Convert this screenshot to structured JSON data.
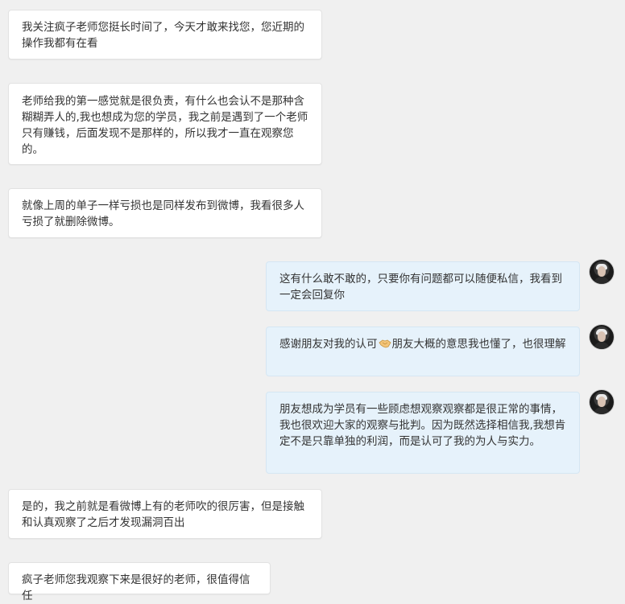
{
  "conversation": {
    "messages": [
      {
        "direction": "incoming",
        "text": "我关注疯子老师您挺长时间了，今天才敢来找您，您近期的操作我都有在看"
      },
      {
        "direction": "incoming",
        "text": "老师给我的第一感觉就是很负责，有什么也会认不是那种含糊糊弄人的,我也想成为您的学员，我之前是遇到了一个老师只有赚钱，后面发现不是那样的，所以我才一直在观察您的。"
      },
      {
        "direction": "incoming",
        "text": "就像上周的单子一样亏损也是同样发布到微博，我看很多人亏损了就删除微博。"
      },
      {
        "direction": "outgoing",
        "text": "这有什么敢不敢的，只要你有问题都可以随便私信，我看到一定会回复你"
      },
      {
        "direction": "outgoing",
        "text_before": "感谢朋友对我的认可",
        "emoji": "handshake-emoji",
        "text_after": "朋友大概的意思我也懂了，也很理解"
      },
      {
        "direction": "outgoing",
        "text": "朋友想成为学员有一些顾虑想观察观察都是很正常的事情，我也很欢迎大家的观察与批判。因为既然选择相信我,我想肯定不是只靠单独的利润，而是认可了我的为人与实力。"
      },
      {
        "direction": "incoming",
        "text": "是的，我之前就是看微博上有的老师吹的很厉害，但是接触和认真观察了之后才发现漏洞百出"
      },
      {
        "direction": "incoming",
        "text": "疯子老师您我观察下来是很好的老师，很值得信任"
      }
    ]
  },
  "colors": {
    "background": "#f0f0f0",
    "incoming_bubble": "#ffffff",
    "outgoing_bubble": "#e6f2fb",
    "text": "#333333"
  }
}
